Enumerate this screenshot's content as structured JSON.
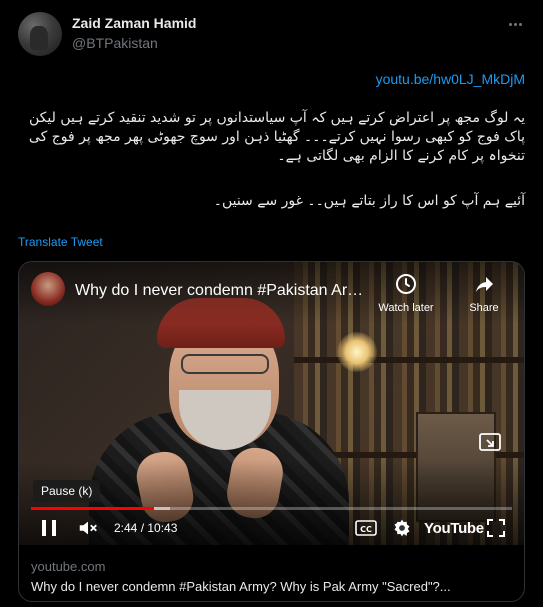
{
  "author": {
    "name": "Zaid Zaman Hamid",
    "handle": "@BTPakistan"
  },
  "tweet": {
    "link": "youtu.be/hw0LJ_MkDjM",
    "paragraph1": "یہ لوگ مجھ پر اعتراض کرتے ہیں کہ آپ سیاستدانوں پر تو شدید تنقید کرتے ہیں لیکن پاک فوج کو کبھی رسوا نہیں کرتے۔۔۔ گھٹیا ذہن اور سوچ جھوٹی پھر مجھ پر فوج کی تنخواہ پر کام کرنے کا الزام بھی لگاتی ہے۔",
    "paragraph2": "آئیے ہم آپ کو اس کا راز بتاتے ہیں۔۔ غور سے سنیں۔",
    "translate_label": "Translate Tweet"
  },
  "video": {
    "title": "Why do I never condemn #Pakistan Army? Why is Pak Army \"Sacred\"?",
    "watch_later_label": "Watch later",
    "share_label": "Share",
    "tooltip": "Pause (k)",
    "current_time": "2:44",
    "duration": "10:43",
    "time_display": "2:44 / 10:43",
    "progress_fraction": 0.255,
    "buffered_fraction": 0.29,
    "brand": "YouTube",
    "progress_color": "#ff0000"
  },
  "card": {
    "domain": "youtube.com",
    "title": "Why do I never condemn #Pakistan Army? Why is Pak Army \"Sacred\"?..."
  },
  "icons": [
    "more-icon",
    "clock-icon",
    "share-arrow-icon",
    "cast-icon",
    "pause-icon",
    "muted-speaker-icon",
    "captions-icon",
    "gear-icon",
    "fullscreen-icon"
  ]
}
